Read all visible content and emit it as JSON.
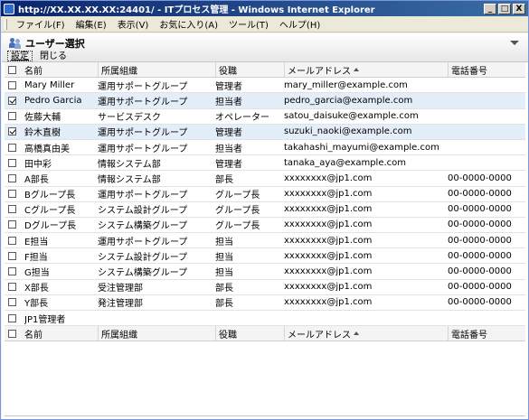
{
  "window": {
    "title": "http://XX.XX.XX.XX:24401/ - ITプロセス管理 - Windows Internet Explorer",
    "minimize": "_",
    "maximize": "□",
    "close": "X"
  },
  "menubar": [
    "ファイル(F)",
    "編集(E)",
    "表示(V)",
    "お気に入り(A)",
    "ツール(T)",
    "ヘルプ(H)"
  ],
  "panel": {
    "title": "ユーザー選択",
    "settings_label": "設定",
    "close_label": "閉じる"
  },
  "table": {
    "columns": [
      "名前",
      "所属組織",
      "役職",
      "メールアドレス",
      "電話番号"
    ],
    "rows": [
      {
        "checked": false,
        "name": "Mary Miller",
        "org": "運用サポートグループ",
        "role": "管理者",
        "mail": "mary_miller@example.com",
        "tel": ""
      },
      {
        "checked": true,
        "name": "Pedro Garcia",
        "org": "運用サポートグループ",
        "role": "担当者",
        "mail": "pedro_garcia@example.com",
        "tel": ""
      },
      {
        "checked": false,
        "name": "佐藤大輔",
        "org": "サービスデスク",
        "role": "オペレーター",
        "mail": "satou_daisuke@example.com",
        "tel": ""
      },
      {
        "checked": true,
        "name": "鈴木直樹",
        "org": "運用サポートグループ",
        "role": "管理者",
        "mail": "suzuki_naoki@example.com",
        "tel": ""
      },
      {
        "checked": false,
        "name": "高橋真由美",
        "org": "運用サポートグループ",
        "role": "担当者",
        "mail": "takahashi_mayumi@example.com",
        "tel": ""
      },
      {
        "checked": false,
        "name": "田中彩",
        "org": "情報システム部",
        "role": "管理者",
        "mail": "tanaka_aya@example.com",
        "tel": ""
      },
      {
        "checked": false,
        "name": "A部長",
        "org": "情報システム部",
        "role": "部長",
        "mail": "xxxxxxxx@jp1.com",
        "tel": "00-0000-0000"
      },
      {
        "checked": false,
        "name": "Bグループ長",
        "org": "運用サポートグループ",
        "role": "グループ長",
        "mail": "xxxxxxxx@jp1.com",
        "tel": "00-0000-0000"
      },
      {
        "checked": false,
        "name": "Cグループ長",
        "org": "システム設計グループ",
        "role": "グループ長",
        "mail": "xxxxxxxx@jp1.com",
        "tel": "00-0000-0000"
      },
      {
        "checked": false,
        "name": "Dグループ長",
        "org": "システム構築グループ",
        "role": "グループ長",
        "mail": "xxxxxxxx@jp1.com",
        "tel": "00-0000-0000"
      },
      {
        "checked": false,
        "name": "E担当",
        "org": "運用サポートグループ",
        "role": "担当",
        "mail": "xxxxxxxx@jp1.com",
        "tel": "00-0000-0000"
      },
      {
        "checked": false,
        "name": "F担当",
        "org": "システム設計グループ",
        "role": "担当",
        "mail": "xxxxxxxx@jp1.com",
        "tel": "00-0000-0000"
      },
      {
        "checked": false,
        "name": "G担当",
        "org": "システム構築グループ",
        "role": "担当",
        "mail": "xxxxxxxx@jp1.com",
        "tel": "00-0000-0000"
      },
      {
        "checked": false,
        "name": "X部長",
        "org": "受注管理部",
        "role": "部長",
        "mail": "xxxxxxxx@jp1.com",
        "tel": "00-0000-0000"
      },
      {
        "checked": false,
        "name": "Y部長",
        "org": "発注管理部",
        "role": "部長",
        "mail": "xxxxxxxx@jp1.com",
        "tel": "00-0000-0000"
      },
      {
        "checked": false,
        "name": "JP1管理者",
        "org": "",
        "role": "",
        "mail": "",
        "tel": ""
      }
    ]
  }
}
